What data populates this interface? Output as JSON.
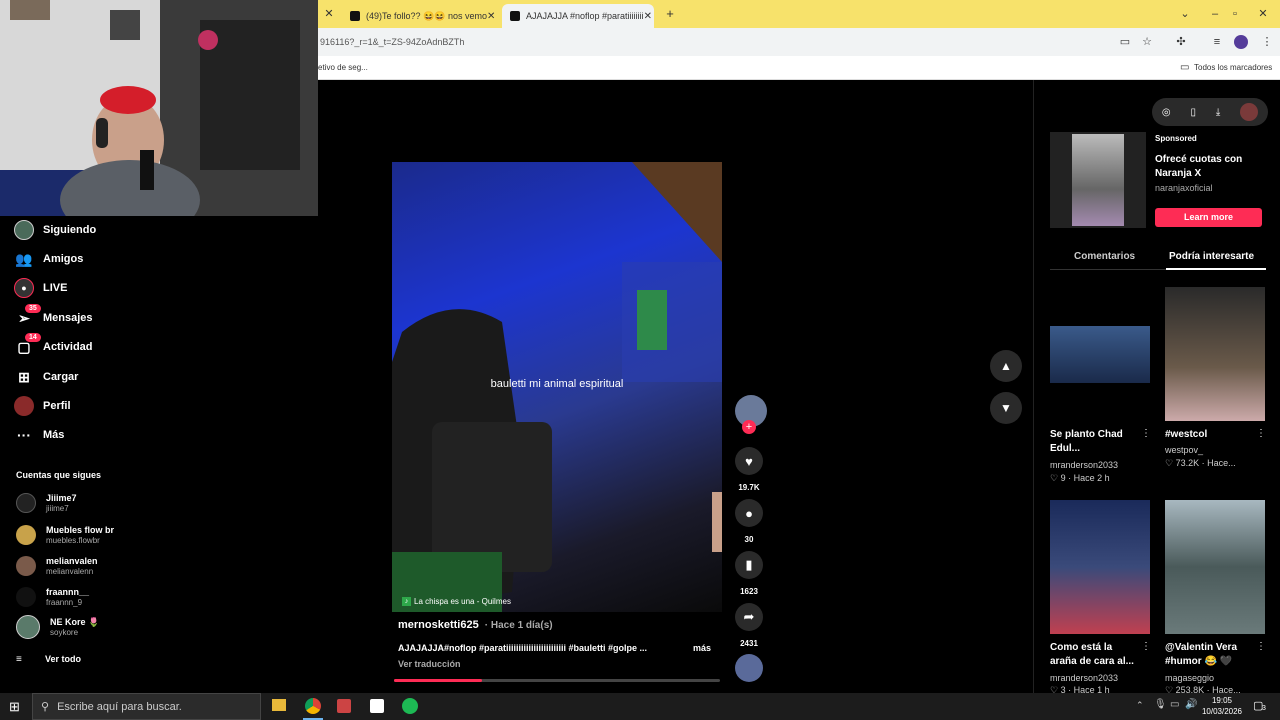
{
  "browser": {
    "tabs": [
      {
        "title": "(49)Te follo?? 😆😆 nos vemo",
        "active": false
      },
      {
        "title": "AJAJAJJA #noflop #paratiiiiiiii",
        "active": true
      }
    ],
    "new_tab": "+",
    "url": "916116?_r=1&_t=ZS-94ZoAdnBZTh",
    "bookmark_left": "etivo de seg...",
    "bookmark_right": "Todos los marcadores"
  },
  "sidebar": {
    "items": [
      {
        "label": "Siguiendo",
        "icon": "following-avatar-icon"
      },
      {
        "label": "Amigos",
        "icon": "friends-icon"
      },
      {
        "label": "LIVE",
        "icon": "live-icon"
      },
      {
        "label": "Mensajes",
        "icon": "messages-icon",
        "badge": "35"
      },
      {
        "label": "Actividad",
        "icon": "activity-icon",
        "badge": "14"
      },
      {
        "label": "Cargar",
        "icon": "upload-icon"
      },
      {
        "label": "Perfil",
        "icon": "profile-icon"
      },
      {
        "label": "Más",
        "icon": "more-icon"
      }
    ],
    "following_heading": "Cuentas que sigues",
    "following": [
      {
        "name": "Jiiime7",
        "handle": "jiiime7"
      },
      {
        "name": "Muebles flow br",
        "handle": "muebles.flowbr"
      },
      {
        "name": "melianvalen",
        "handle": "melianvalenn"
      },
      {
        "name": "fraannn__",
        "handle": "fraannn_9"
      },
      {
        "name": "NE Kore 🌷",
        "handle": "soykore"
      }
    ],
    "see_all": "Ver todo"
  },
  "video": {
    "overlay_text": "bauletti mi animal espiritual",
    "music": "La chispa es una - Quilmes",
    "author": "mernosketti625",
    "time": "· Hace 1 día(s)",
    "caption": "AJAJAJJA#noflop #paratiiiiiiiiiiiiiiiiiiiiiiii #bauletti #golpe ...",
    "more": "más",
    "translate": "Ver traducción",
    "progress": 0.27,
    "likes": "19.7K",
    "comments": "30",
    "saves": "1623",
    "shares": "2431"
  },
  "right_panel": {
    "sponsored_label": "Sponsored",
    "ad_title": "Ofrecé cuotas con Naranja X",
    "ad_account": "naranjaxoficial",
    "ad_button": "Learn more",
    "tabs": [
      "Comentarios",
      "Podría interesarte"
    ],
    "cards": [
      {
        "title": "Se planto Chad Edul...",
        "author": "mranderson2033",
        "meta": "♡ 9  · Hace 2 h"
      },
      {
        "title": "#westcol",
        "author": "westpov_",
        "meta": "♡ 73.2K  · Hace..."
      },
      {
        "title": "Como está la araña de cara al...",
        "author": "mranderson2033",
        "meta": "♡ 3  · Hace 1 h"
      },
      {
        "title": "@Valentin Vera #humor 😂 🖤",
        "author": "magaseggio",
        "meta": "♡ 253.8K  · Hace..."
      }
    ]
  },
  "taskbar": {
    "search_placeholder": "Escribe aquí para buscar.",
    "time": "19:05",
    "date": "10/03/2026",
    "notification_count": "3"
  },
  "colors": {
    "accent": "#fe2c55",
    "tabbar": "#f7e26b"
  }
}
